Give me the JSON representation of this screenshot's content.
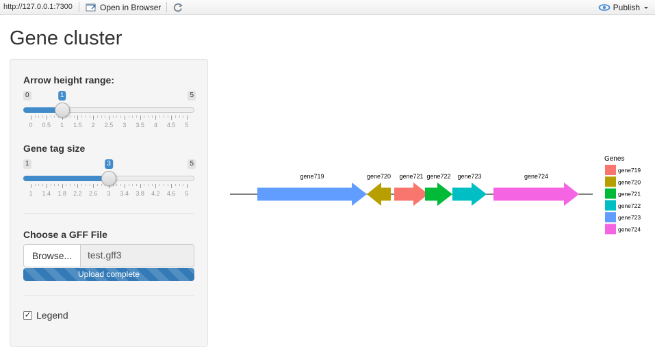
{
  "toolbar": {
    "url": "http://127.0.0.1:7300",
    "open_in_browser": "Open in Browser",
    "publish": "Publish"
  },
  "page": {
    "title": "Gene cluster"
  },
  "arrow_height": {
    "label": "Arrow height range:",
    "min": 0,
    "max": 5,
    "value": 1,
    "min_label": "0",
    "max_label": "5",
    "value_label": "1",
    "ticks": [
      "0",
      "0.5",
      "1",
      "1.5",
      "2",
      "2.5",
      "3",
      "3.5",
      "4",
      "4.5",
      "5"
    ]
  },
  "tag_size": {
    "label": "Gene tag size",
    "min": 1,
    "max": 5,
    "value": 3,
    "min_label": "1",
    "max_label": "5",
    "value_label": "3",
    "ticks": [
      "1",
      "1.4",
      "1.8",
      "2.2",
      "2.6",
      "3",
      "3.4",
      "3.8",
      "4.2",
      "4.6",
      "5"
    ]
  },
  "file": {
    "label": "Choose a GFF File",
    "browse": "Browse...",
    "filename": "test.gff3",
    "status": "Upload complete",
    "progress": 1.0
  },
  "legend_checkbox": {
    "label": "Legend",
    "checked": true,
    "check_glyph": "✓"
  },
  "chart_data": {
    "type": "gene-arrow-map",
    "genes": [
      {
        "name": "gene719",
        "start": 0.08,
        "end": 0.4,
        "strand": "+",
        "color": "#619CFF"
      },
      {
        "name": "gene720",
        "start": 0.4,
        "end": 0.47,
        "strand": "-",
        "color": "#B79F00"
      },
      {
        "name": "gene721",
        "start": 0.48,
        "end": 0.58,
        "strand": "+",
        "color": "#F8766D"
      },
      {
        "name": "gene722",
        "start": 0.57,
        "end": 0.65,
        "strand": "+",
        "color": "#00BA38"
      },
      {
        "name": "gene723",
        "start": 0.65,
        "end": 0.75,
        "strand": "+",
        "color": "#00BFC4"
      },
      {
        "name": "gene724",
        "start": 0.77,
        "end": 1.02,
        "strand": "+",
        "color": "#F564E3"
      }
    ],
    "line_range": [
      0,
      1.06
    ],
    "legend": {
      "title": "Genes",
      "entries": [
        {
          "name": "gene719",
          "color": "#F8766D"
        },
        {
          "name": "gene720",
          "color": "#B79F00"
        },
        {
          "name": "gene721",
          "color": "#00BA38"
        },
        {
          "name": "gene722",
          "color": "#00BFC4"
        },
        {
          "name": "gene723",
          "color": "#619CFF"
        },
        {
          "name": "gene724",
          "color": "#F564E3"
        }
      ]
    }
  }
}
